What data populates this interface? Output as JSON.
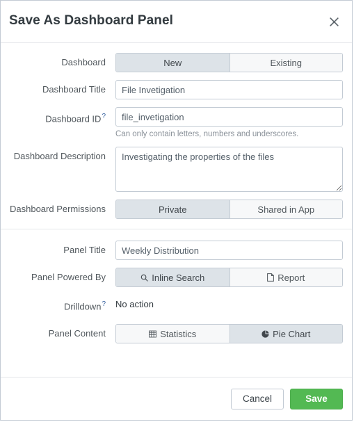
{
  "dialog": {
    "title": "Save As Dashboard Panel",
    "close_icon": "close-icon"
  },
  "colors": {
    "save_button": "#53b953",
    "segment_selected": "#dde3e8",
    "segment_unselected": "#f7f8f9",
    "border": "#c3cbd4",
    "help_link": "#3863a0"
  },
  "dashboard_section": {
    "dashboard": {
      "label": "Dashboard",
      "options": [
        {
          "label": "New",
          "selected": true
        },
        {
          "label": "Existing",
          "selected": false
        }
      ]
    },
    "dashboard_title": {
      "label": "Dashboard Title",
      "value": "File Invetigation",
      "placeholder": ""
    },
    "dashboard_id": {
      "label": "Dashboard ID",
      "help_marker": "?",
      "value": "file_invetigation",
      "placeholder": "",
      "hint": "Can only contain letters, numbers and underscores."
    },
    "dashboard_description": {
      "label": "Dashboard Description",
      "value": "Investigating the properties of the files",
      "placeholder": ""
    },
    "dashboard_permissions": {
      "label": "Dashboard Permissions",
      "options": [
        {
          "label": "Private",
          "selected": true
        },
        {
          "label": "Shared in App",
          "selected": false
        }
      ]
    }
  },
  "panel_section": {
    "panel_title": {
      "label": "Panel Title",
      "value": "Weekly Distribution",
      "placeholder": ""
    },
    "panel_powered_by": {
      "label": "Panel Powered By",
      "options": [
        {
          "label": "Inline Search",
          "icon": "search-icon",
          "selected": true
        },
        {
          "label": "Report",
          "icon": "document-icon",
          "selected": false
        }
      ]
    },
    "drilldown": {
      "label": "Drilldown",
      "help_marker": "?",
      "value": "No action"
    },
    "panel_content": {
      "label": "Panel Content",
      "options": [
        {
          "label": "Statistics",
          "icon": "table-icon",
          "selected": false
        },
        {
          "label": "Pie Chart",
          "icon": "pie-chart-icon",
          "selected": true
        }
      ]
    }
  },
  "footer": {
    "cancel_label": "Cancel",
    "save_label": "Save"
  }
}
